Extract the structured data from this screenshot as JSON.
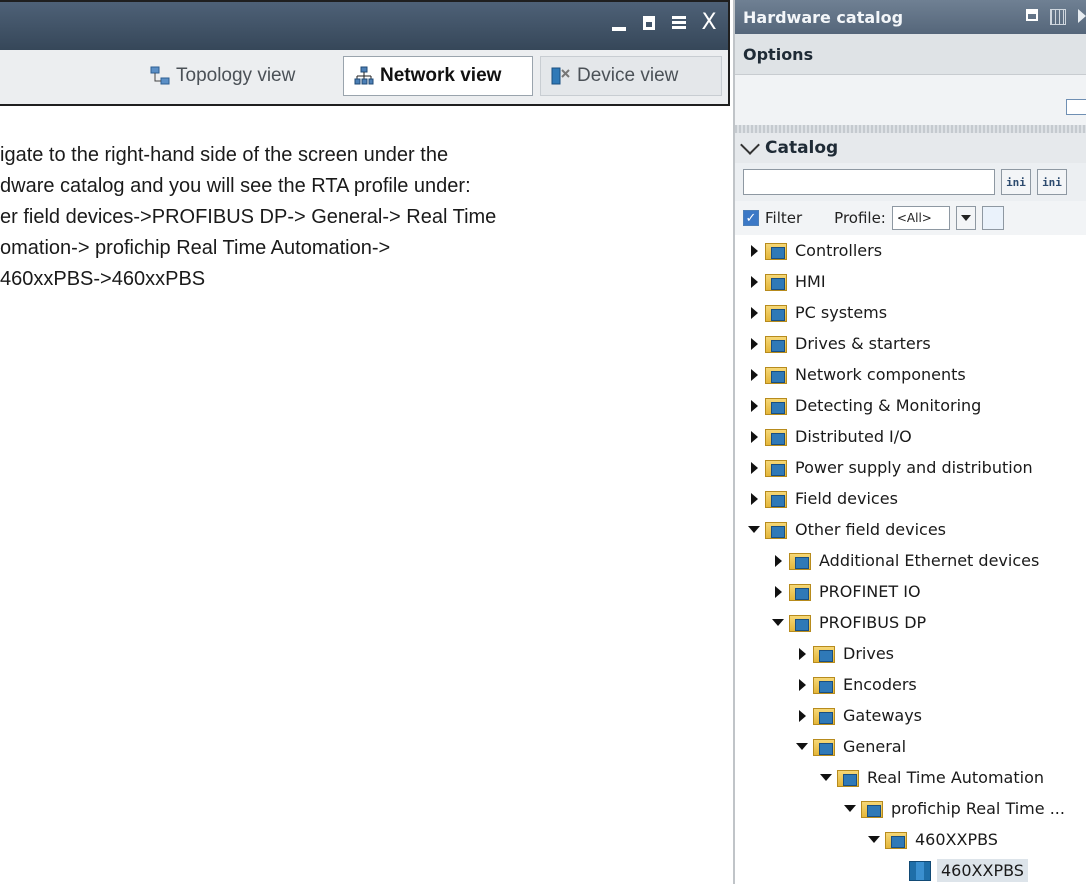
{
  "view_window": {
    "tabs": [
      {
        "label": "Topology view",
        "icon": "topology-icon"
      },
      {
        "label": "Network view",
        "icon": "network-icon"
      },
      {
        "label": "Device view",
        "icon": "device-icon"
      }
    ],
    "window_controls": {
      "close": "X"
    }
  },
  "instructions": [
    "igate to the right-hand side of the screen under the",
    "dware catalog and you will see the RTA profile under:",
    "er field devices->PROFIBUS DP-> General-> Real Time",
    "omation-> profichip Real Time Automation->",
    "460xxPBS->460xxPBS"
  ],
  "hardware_catalog": {
    "title": "Hardware catalog",
    "options_label": "Options",
    "catalog_label": "Catalog",
    "search": {
      "value": "",
      "placeholder": ""
    },
    "search_buttons": [
      "ini",
      "ini"
    ],
    "filter_label": "Filter",
    "profile_label": "Profile:",
    "profile_value": "<All>",
    "tree": [
      {
        "label": "Controllers",
        "state": "collapsed",
        "level": 0
      },
      {
        "label": "HMI",
        "state": "collapsed",
        "level": 0
      },
      {
        "label": "PC systems",
        "state": "collapsed",
        "level": 0
      },
      {
        "label": "Drives & starters",
        "state": "collapsed",
        "level": 0
      },
      {
        "label": "Network components",
        "state": "collapsed",
        "level": 0
      },
      {
        "label": "Detecting & Monitoring",
        "state": "collapsed",
        "level": 0
      },
      {
        "label": "Distributed I/O",
        "state": "collapsed",
        "level": 0
      },
      {
        "label": "Power supply and distribution",
        "state": "collapsed",
        "level": 0
      },
      {
        "label": "Field devices",
        "state": "collapsed",
        "level": 0
      },
      {
        "label": "Other field devices",
        "state": "expanded",
        "level": 0
      },
      {
        "label": "Additional Ethernet devices",
        "state": "collapsed",
        "level": 1
      },
      {
        "label": "PROFINET IO",
        "state": "collapsed",
        "level": 1
      },
      {
        "label": "PROFIBUS DP",
        "state": "expanded",
        "level": 1
      },
      {
        "label": "Drives",
        "state": "collapsed",
        "level": 2
      },
      {
        "label": "Encoders",
        "state": "collapsed",
        "level": 2
      },
      {
        "label": "Gateways",
        "state": "collapsed",
        "level": 2
      },
      {
        "label": "General",
        "state": "expanded",
        "level": 2
      },
      {
        "label": "Real Time Automation",
        "state": "expanded",
        "level": 3
      },
      {
        "label": "profichip Real Time ...",
        "state": "expanded",
        "level": 4
      },
      {
        "label": "460XXPBS",
        "state": "expanded",
        "level": 5
      },
      {
        "label": "460XXPBS",
        "state": "leaf",
        "level": 6,
        "selected": true
      }
    ]
  }
}
